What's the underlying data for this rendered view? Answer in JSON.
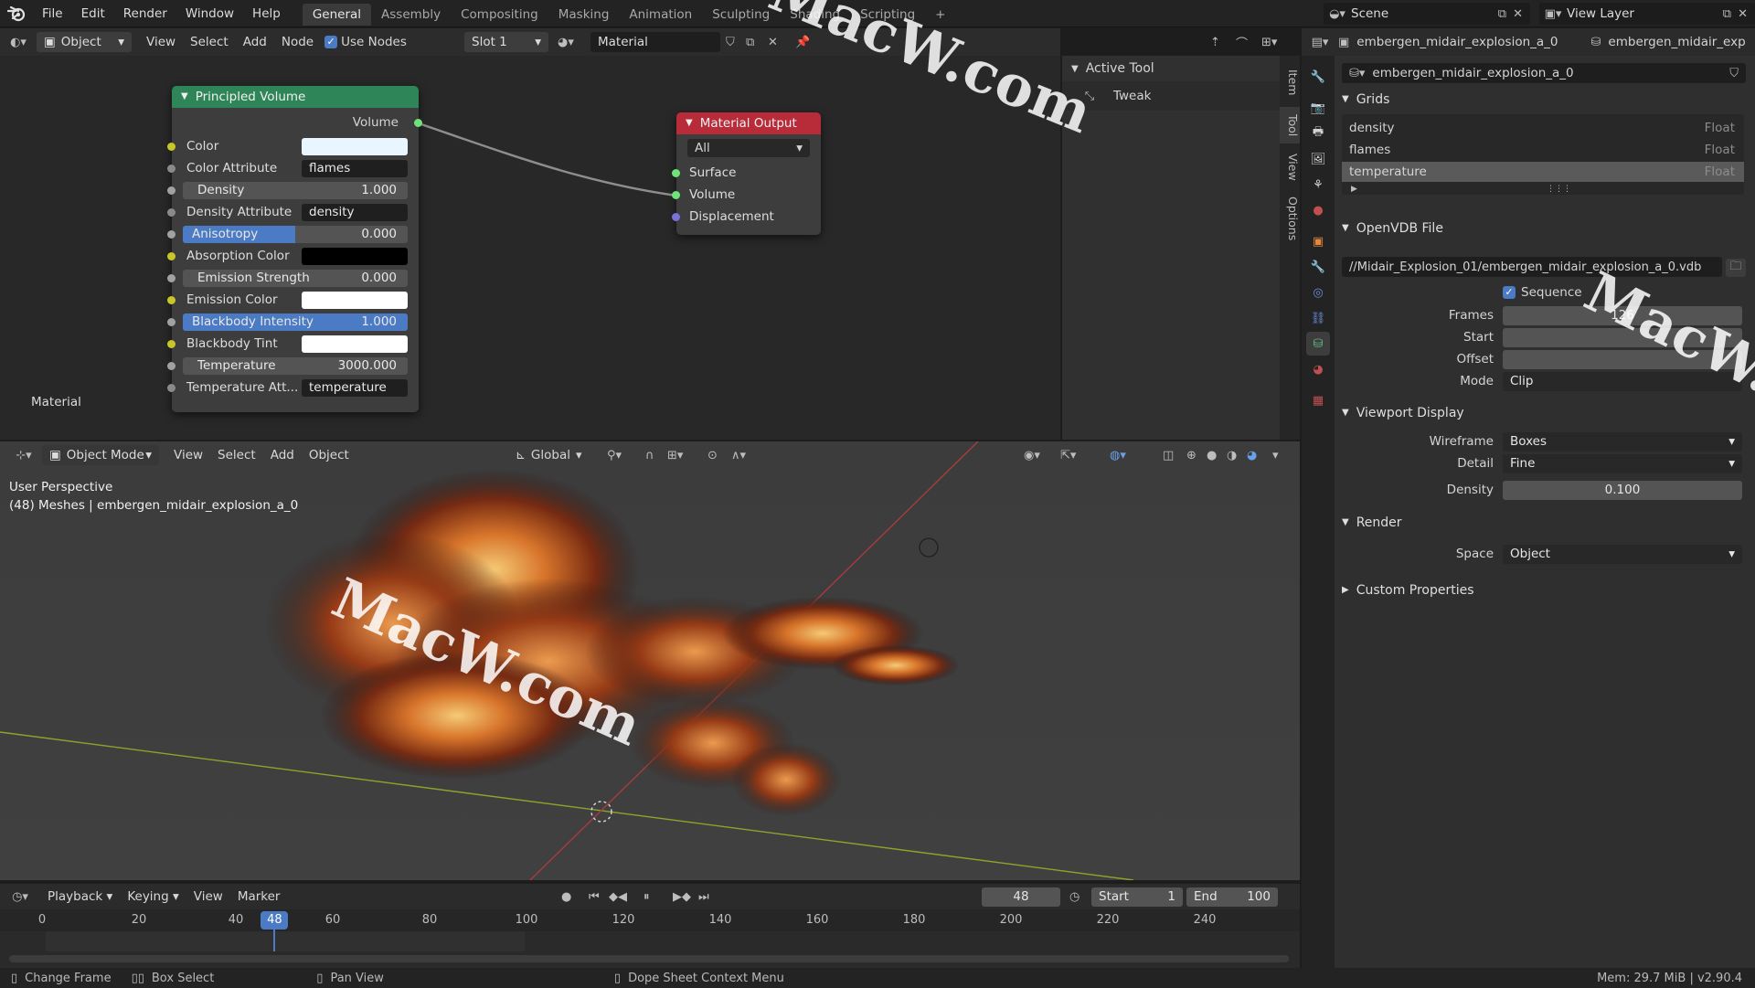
{
  "app": {
    "menu": [
      "File",
      "Edit",
      "Render",
      "Window",
      "Help"
    ],
    "workspaces": [
      "General",
      "Assembly",
      "Compositing",
      "Masking",
      "Animation",
      "Sculpting",
      "Shading",
      "Scripting"
    ],
    "active_workspace": "General",
    "scene": "Scene",
    "view_layer": "View Layer"
  },
  "node_editor": {
    "header": {
      "mode": "Object",
      "menus": [
        "View",
        "Select",
        "Add",
        "Node"
      ],
      "use_nodes_label": "Use Nodes",
      "slot": "Slot 1",
      "material": "Material"
    },
    "corner_label": "Material",
    "principled": {
      "title": "Principled Volume",
      "output": "Volume",
      "rows": {
        "color": "Color",
        "color_attr_label": "Color Attribute",
        "color_attr_value": "flames",
        "density_label": "Density",
        "density_value": "1.000",
        "density_attr_label": "Density Attribute",
        "density_attr_value": "density",
        "anisotropy_label": "Anisotropy",
        "anisotropy_value": "0.000",
        "absorption_label": "Absorption Color",
        "emission_strength_label": "Emission Strength",
        "emission_strength_value": "0.000",
        "emission_color_label": "Emission Color",
        "blackbody_intensity_label": "Blackbody Intensity",
        "blackbody_intensity_value": "1.000",
        "blackbody_tint_label": "Blackbody Tint",
        "temperature_label": "Temperature",
        "temperature_value": "3000.000",
        "temp_attr_label": "Temperature Att...",
        "temp_attr_value": "temperature"
      },
      "anisotropy_fill": 0.5,
      "blackbody_fill": 1.0
    },
    "output": {
      "title": "Material Output",
      "target": "All",
      "inputs": [
        "Surface",
        "Volume",
        "Displacement"
      ]
    },
    "npanel": {
      "section": "Active Tool",
      "tool": "Tweak",
      "tabs": [
        "Item",
        "Tool",
        "View",
        "Options"
      ]
    }
  },
  "viewport": {
    "mode": "Object Mode",
    "menus": [
      "View",
      "Select",
      "Add",
      "Object"
    ],
    "orientation": "Global",
    "overlay_title": "User Perspective",
    "overlay_info": "(48) Meshes | embergen_midair_explosion_a_0"
  },
  "timeline": {
    "menus": [
      "Playback",
      "Keying",
      "View",
      "Marker"
    ],
    "current_frame": "48",
    "start_label": "Start",
    "start_value": "1",
    "end_label": "End",
    "end_value": "100",
    "ticks": [
      "0",
      "20",
      "40",
      "60",
      "80",
      "100",
      "120",
      "140",
      "160",
      "180",
      "200",
      "220",
      "240"
    ],
    "playhead": "48"
  },
  "status": {
    "items": [
      "Change Frame",
      "Box Select",
      "Pan View",
      "Dope Sheet Context Menu"
    ],
    "memory": "Mem: 29.7 MiB | v2.90.4"
  },
  "properties": {
    "object_name": "embergen_midair_explosion_a_0",
    "object_name_2": "embergen_midair_exp",
    "data_name": "embergen_midair_explosion_a_0",
    "grids": {
      "title": "Grids",
      "items": [
        {
          "name": "density",
          "type": "Float"
        },
        {
          "name": "flames",
          "type": "Float"
        },
        {
          "name": "temperature",
          "type": "Float"
        }
      ],
      "selected": "temperature"
    },
    "openvdb": {
      "title": "OpenVDB File",
      "path": "//Midair_Explosion_01/embergen_midair_explosion_a_0.vdb",
      "sequence_label": "Sequence",
      "frames_label": "Frames",
      "frames_value": "126",
      "start_label": "Start",
      "offset_label": "Offset",
      "mode_label": "Mode",
      "mode_value": "Clip"
    },
    "viewport_display": {
      "title": "Viewport Display",
      "wireframe_label": "Wireframe",
      "wireframe_value": "Boxes",
      "detail_label": "Detail",
      "detail_value": "Fine",
      "density_label": "Density",
      "density_value": "0.100"
    },
    "render": {
      "title": "Render",
      "space_label": "Space",
      "space_value": "Object"
    },
    "custom_title": "Custom Properties"
  },
  "watermark": "MacW.com"
}
